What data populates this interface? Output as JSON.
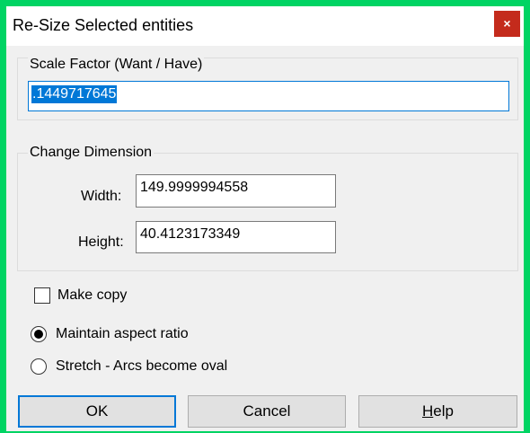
{
  "window": {
    "title": "Re-Size Selected entities",
    "close_glyph": "×"
  },
  "scale_group": {
    "label": "Scale Factor  (Want / Have)",
    "value": ".1449717645"
  },
  "dimension_group": {
    "label": "Change Dimension",
    "width_label": "Width:",
    "width_value": "149.9999994558",
    "height_label": "Height:",
    "height_value": "40.4123173349"
  },
  "options": {
    "make_copy_label": "Make copy",
    "make_copy_checked": false,
    "maintain_aspect_label": "Maintain aspect ratio",
    "maintain_aspect_selected": true,
    "stretch_label": "Stretch - Arcs become oval",
    "stretch_selected": false
  },
  "buttons": {
    "ok": "OK",
    "cancel": "Cancel",
    "help": "Help"
  },
  "colors": {
    "window_border": "#00d463",
    "close_button": "#c42b1c",
    "selection": "#0078d7"
  }
}
